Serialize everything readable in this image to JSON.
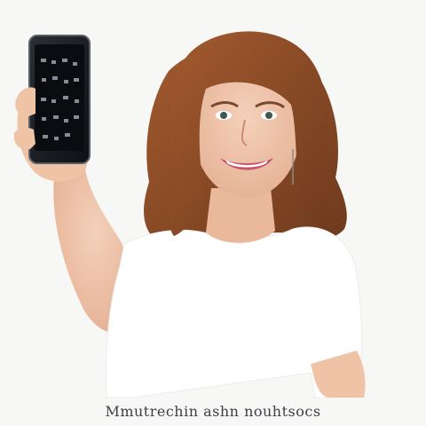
{
  "caption": "Mmutrechin ashn nouhtsocs",
  "colors": {
    "background": "#f7f7f6",
    "hair": "#8a4a26",
    "skin": "#efc7ad",
    "dress": "#ffffff",
    "phone": "#1a1d22",
    "caption_text": "#3a3f4a"
  }
}
